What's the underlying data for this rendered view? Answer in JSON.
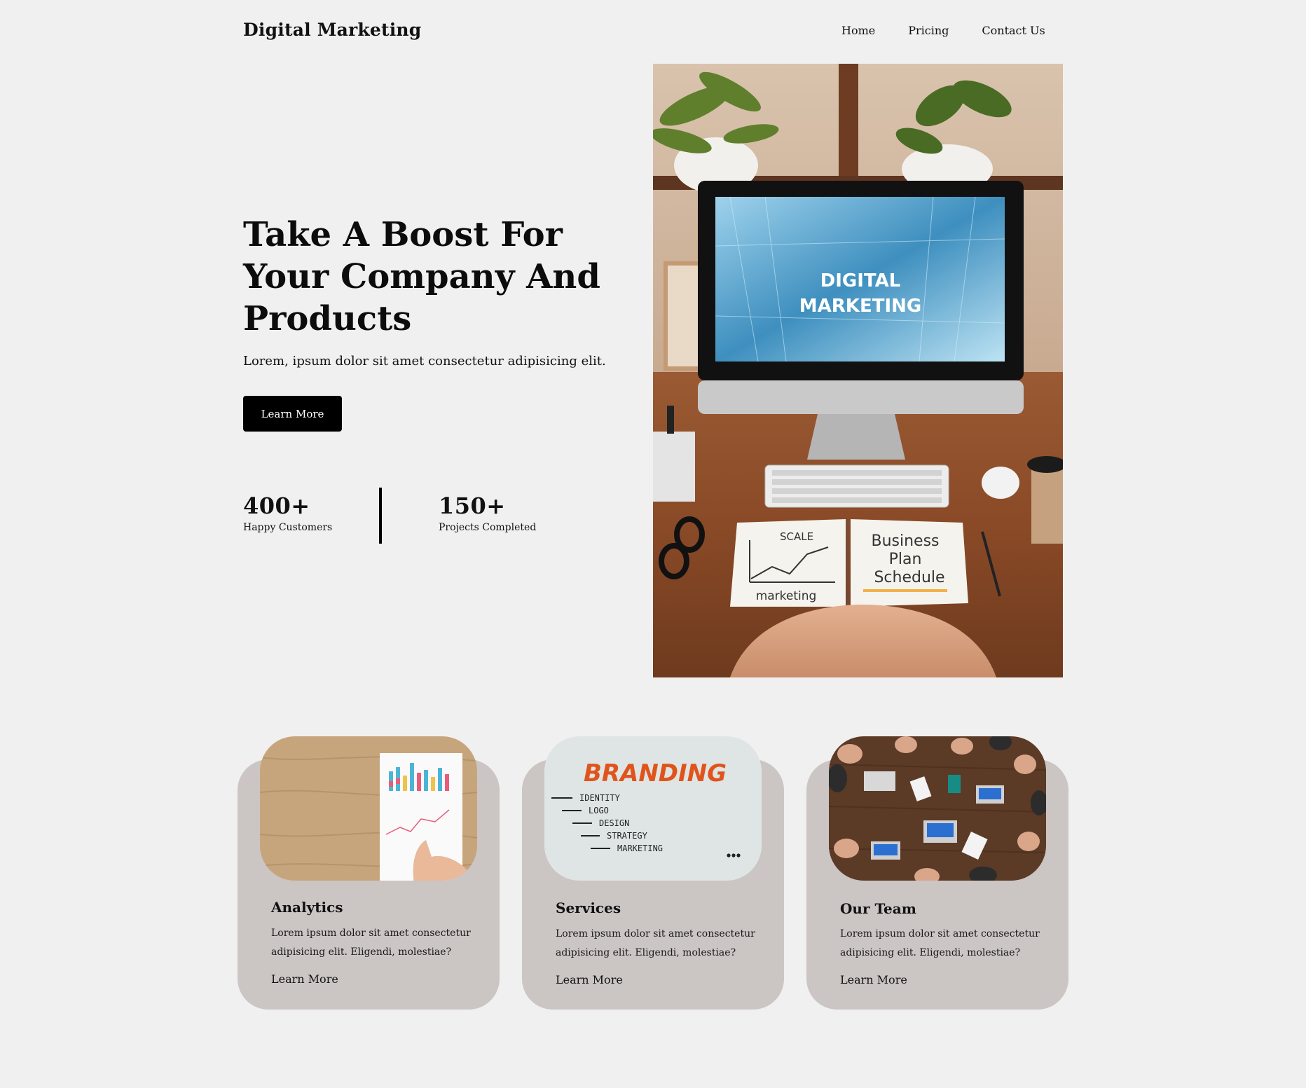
{
  "header": {
    "brand": "Digital Marketing",
    "nav": [
      "Home",
      "Pricing",
      "Contact Us"
    ]
  },
  "hero": {
    "title": "Take A Boost For Your Company And Products",
    "subtitle": "Lorem, ipsum dolor sit amet consectetur adipisicing elit.",
    "cta_label": "Learn More",
    "image": {
      "screen_line1": "DIGITAL",
      "screen_line2": "MARKETING",
      "notebook_left_top": "SCALE",
      "notebook_left_bottom": "marketing",
      "notebook_right_1": "Business",
      "notebook_right_2": "Plan",
      "notebook_right_3": "Schedule"
    }
  },
  "stats": [
    {
      "number": "400+",
      "label": "Happy Customers"
    },
    {
      "number": "150+",
      "label": "Projects Completed"
    }
  ],
  "cards": [
    {
      "title": "Analytics",
      "text": "Lorem ipsum dolor sit amet consectetur adipisicing elit. Eligendi, molestiae?",
      "link": "Learn More"
    },
    {
      "title": "Services",
      "text": "Lorem ipsum dolor sit amet consectetur adipisicing elit. Eligendi, molestiae?",
      "link": "Learn More",
      "image_text": {
        "heading": "BRANDING",
        "items": [
          "IDENTITY",
          "LOGO",
          "DESIGN",
          "STRATEGY",
          "MARKETING"
        ]
      }
    },
    {
      "title": "Our Team",
      "text": "Lorem ipsum dolor sit amet consectetur adipisicing elit. Eligendi, molestiae?",
      "link": "Learn More"
    }
  ],
  "colors": {
    "background": "#f0f0f0",
    "card": "#cbc5c4",
    "button": "#000000",
    "branding_orange": "#e0541c"
  }
}
